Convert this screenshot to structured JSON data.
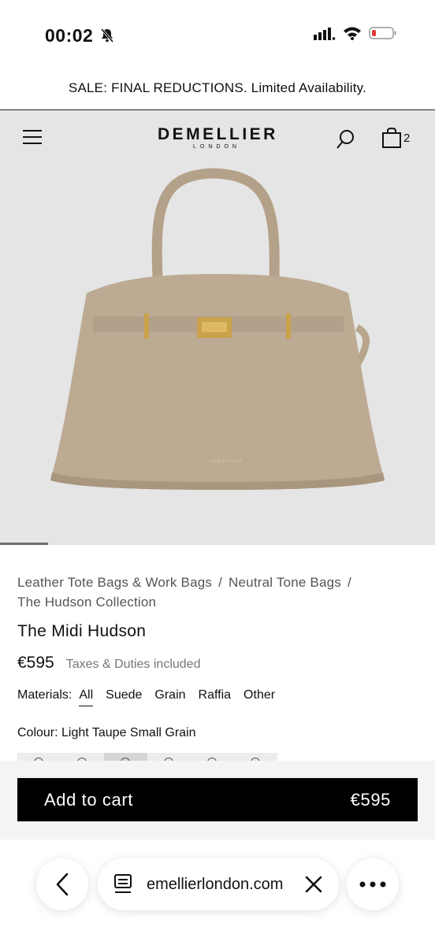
{
  "status_bar": {
    "time": "00:02",
    "icons": [
      "bell-slash-icon",
      "signal-icon",
      "wifi-icon",
      "battery-low-icon"
    ]
  },
  "promo": {
    "text": "SALE: FINAL REDUCTIONS. Limited Availability."
  },
  "header": {
    "logo_main": "DEMELLIER",
    "logo_sub": "LONDON",
    "cart_count": "2",
    "icons": [
      "menu-icon",
      "search-icon",
      "shopping-bag-icon"
    ]
  },
  "hero": {
    "product_imprint": "DEMELLIER",
    "gallery_progress": 0.11
  },
  "breadcrumb": {
    "items": [
      "Leather Tote Bags & Work Bags",
      "Neutral Tone Bags",
      "The Hudson Collection"
    ],
    "separator": "/"
  },
  "product": {
    "title": "The Midi Hudson",
    "price": "€595",
    "tax_note": "Taxes & Duties included",
    "materials_label": "Materials:",
    "materials": [
      "All",
      "Suede",
      "Grain",
      "Raffia",
      "Other"
    ],
    "materials_selected": "All",
    "colour_label": "Colour: Light Taupe Small Grain"
  },
  "cart_button": {
    "label": "Add to cart",
    "price": "€595"
  },
  "browser": {
    "url": "emellierlondon.com",
    "icons": [
      "back-icon",
      "page-icon",
      "close-icon",
      "more-icon"
    ]
  },
  "colors": {
    "hero_bg": "#e5e5e5",
    "bag": "#bcaa93",
    "hardware": "#c9a24a",
    "button": "#000000"
  }
}
